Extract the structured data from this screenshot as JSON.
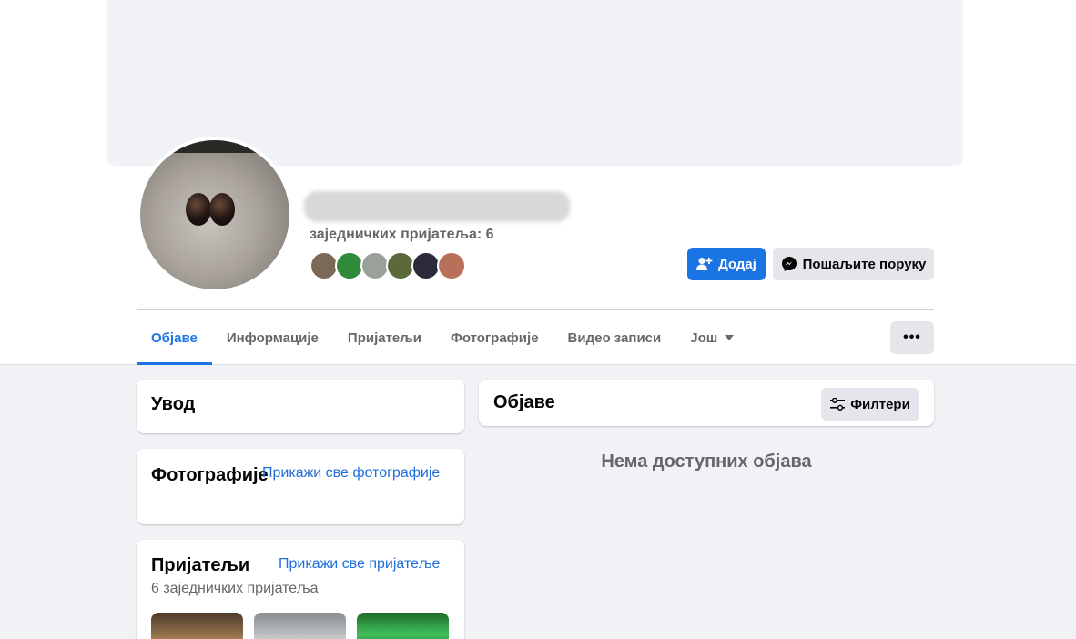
{
  "profile": {
    "mutual_friends_label": "заједничких пријатеља: 6",
    "friend_avatar_colors": [
      "#7a6a55",
      "#2f8a3a",
      "#9aa09a",
      "#5a6a3a",
      "#2a2a3a",
      "#b9705a"
    ]
  },
  "actions": {
    "add_label": "Додај",
    "message_label": "Пошаљите поруку",
    "more_label": "•••"
  },
  "tabs": [
    {
      "label": "Објаве"
    },
    {
      "label": "Информације"
    },
    {
      "label": "Пријатељи"
    },
    {
      "label": "Фотографије"
    },
    {
      "label": "Видео записи"
    },
    {
      "label": "Још"
    }
  ],
  "intro": {
    "title": "Увод"
  },
  "photos": {
    "title": "Фотографије",
    "link": "Прикажи све фотографије"
  },
  "friends": {
    "title": "Пријатељи",
    "link": "Прикажи све пријатеље",
    "subtitle": "6 заједничких пријатеља"
  },
  "posts": {
    "title": "Објаве",
    "filters_label": "Филтери",
    "empty_label": "Нема доступних објава"
  },
  "colors": {
    "accent": "#1b74e4",
    "link": "#216fdb",
    "background": "#f0f2f5"
  }
}
